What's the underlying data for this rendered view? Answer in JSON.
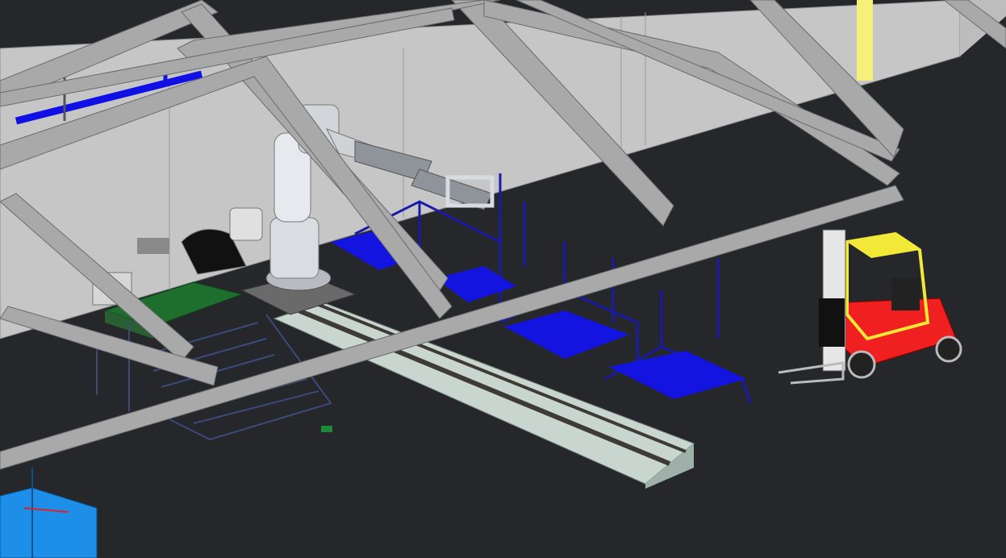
{
  "viewport": {
    "background": "#26272b"
  },
  "colors": {
    "wall": "#c6c6c6",
    "wall_edge": "#8a8a8a",
    "beam": "#a9a9a9",
    "beam_edge": "#6a6a6a",
    "pallet_blue": "#1414e0",
    "rack_blue": "#1a1aa8",
    "conveyor_green": "#1e6e2e",
    "rail_pale": "#c9d6d0",
    "robot": "#d9dde2",
    "forklift_body": "#f02020",
    "forklift_cage": "#f2e838",
    "pipe_blue": "#1010e6",
    "container_blue": "#1d8fe8",
    "safety_stripe": "#f5f07a"
  },
  "icons": {
    "robot": "industrial-robot-icon",
    "forklift": "forklift-icon"
  }
}
